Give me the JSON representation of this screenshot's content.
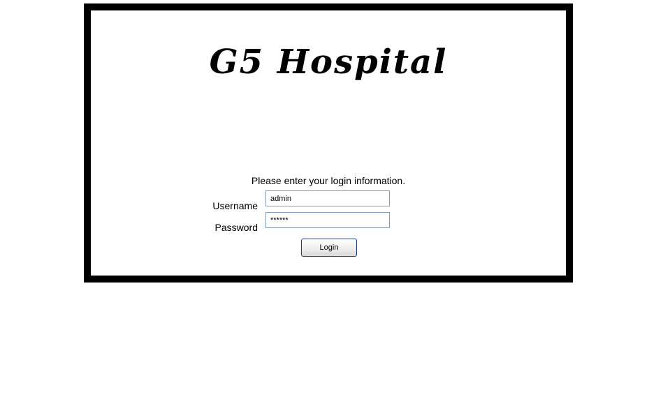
{
  "app": {
    "title": "G5 Hospital"
  },
  "login": {
    "prompt": "Please enter your login information.",
    "username_label": "Username",
    "username_value": "admin",
    "password_label": "Password",
    "password_value": "******",
    "submit_label": "Login"
  },
  "colors": {
    "frame": "#000000",
    "panel": "#ffffff",
    "field_border": "#7f9db9",
    "button_border": "#1c3f72"
  }
}
